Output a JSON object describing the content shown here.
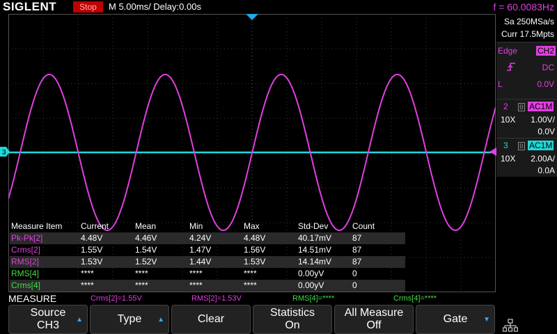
{
  "header": {
    "brand": "SIGLENT",
    "run_state": "Stop",
    "timebase": "M 5.00ms/ Delay:0.00s",
    "frequency": "f = 60.0083Hz"
  },
  "acquire": {
    "sample_rate": "Sa 250MSa/s",
    "memory": "Curr 17.5Mpts"
  },
  "trigger": {
    "type": "Edge",
    "source": "CH2",
    "slope_icon": "rising-edge-icon",
    "coupling": "DC",
    "level_label": "L",
    "level": "0.0V"
  },
  "channels": [
    {
      "num": "2",
      "b": "B",
      "coupling": "AC1M",
      "probe": "10X",
      "scale": "1.00V/",
      "offset": "0.0V",
      "color": "#e040e0"
    },
    {
      "num": "3",
      "b": "B",
      "coupling": "AC1M",
      "probe": "10X",
      "scale": "2.00A/",
      "offset": "0.0A",
      "color": "#20d8d8"
    }
  ],
  "markers": {
    "left_ch3": "3",
    "right_ch3": "3"
  },
  "measure_table": {
    "headers": [
      "Measure Item",
      "Current",
      "Mean",
      "Min",
      "Max",
      "Std-Dev",
      "Count"
    ],
    "rows": [
      {
        "item": "Pk-Pk[2]",
        "current": "4.48V",
        "mean": "4.46V",
        "min": "4.24V",
        "max": "4.48V",
        "stddev": "40.17mV",
        "count": "87",
        "color": "#e040e0"
      },
      {
        "item": "Crms[2]",
        "current": "1.55V",
        "mean": "1.54V",
        "min": "1.47V",
        "max": "1.56V",
        "stddev": "14.51mV",
        "count": "87",
        "color": "#e040e0"
      },
      {
        "item": "RMS[2]",
        "current": "1.53V",
        "mean": "1.52V",
        "min": "1.44V",
        "max": "1.53V",
        "stddev": "14.14mV",
        "count": "87",
        "color": "#e040e0"
      },
      {
        "item": "RMS[4]",
        "current": "****",
        "mean": "****",
        "min": "****",
        "max": "****",
        "stddev": "0.00yV",
        "count": "0",
        "color": "#40e040"
      },
      {
        "item": "Crms[4]",
        "current": "****",
        "mean": "****",
        "min": "****",
        "max": "****",
        "stddev": "0.00yV",
        "count": "0",
        "color": "#40e040"
      }
    ]
  },
  "measure_bar": {
    "title": "MEASURE",
    "items": [
      {
        "text": "Crms[2]=1.55V",
        "color": "#e040e0"
      },
      {
        "text": "RMS[2]=1.53V",
        "color": "#e040e0"
      },
      {
        "text": "RMS[4]=****",
        "color": "#40e040"
      },
      {
        "text": "Crms[4]=****",
        "color": "#40e040"
      }
    ]
  },
  "softkeys": [
    {
      "line1": "Source",
      "line2": "CH3",
      "arrow": "up"
    },
    {
      "line1": "Type",
      "line2": "",
      "arrow": "up"
    },
    {
      "line1": "Clear",
      "line2": "",
      "arrow": ""
    },
    {
      "line1": "Statistics",
      "line2": "On",
      "arrow": ""
    },
    {
      "line1": "All Measure",
      "line2": "Off",
      "arrow": ""
    },
    {
      "line1": "Gate",
      "line2": "",
      "arrow": "down"
    }
  ],
  "network_icon": "network-icon",
  "traces": {
    "ch2": {
      "color": "#e040e0",
      "frequency_hz": 60.0083,
      "peak_volts": 2.24,
      "volts_per_div": 1.0,
      "ms_per_div": 5.0
    },
    "ch3": {
      "color": "#20d8d8",
      "level_amps": 0.0
    }
  }
}
